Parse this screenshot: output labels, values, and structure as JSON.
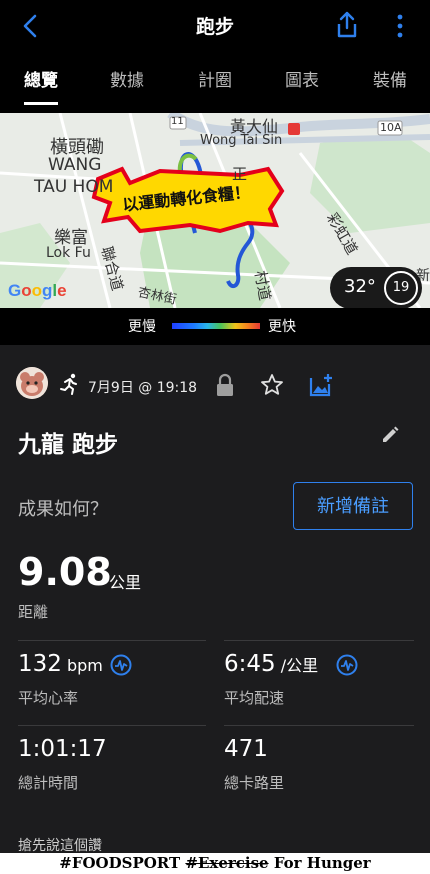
{
  "header": {
    "title": "跑步"
  },
  "tabs": [
    {
      "label": "總覽"
    },
    {
      "label": "數據"
    },
    {
      "label": "計圈"
    },
    {
      "label": "圖表"
    },
    {
      "label": "裝備"
    }
  ],
  "map": {
    "labels": {
      "wong_tai_sin_zh": "黃大仙",
      "wong_tai_sin_en": "Wong Tai Sin",
      "wang_tau_hom_zh": "橫頭磡",
      "wang_tau_hom_en1": "WANG",
      "wang_tau_hom_en2": "TAU HOM",
      "lok_fu_zh": "樂富",
      "lok_fu_en": "Lok Fu",
      "route_10a": "10A",
      "route_11": "11",
      "street_1": "聯合道",
      "street_2": "杏林街",
      "street_3": "村道",
      "street_4": "彩虹道",
      "street_5": "正",
      "edge": "新"
    },
    "sticker": "以運動轉化食糧！",
    "google": "Google",
    "temperature": "32°",
    "wind": "19"
  },
  "legend": {
    "slower": "更慢",
    "faster": "更快"
  },
  "activity": {
    "date": "7月9日 @ 19:18",
    "title": "九龍 跑步",
    "prompt": "成果如何？",
    "add_note": "新增備註",
    "distance": {
      "value": "9.08",
      "unit": "公里",
      "label": "距離"
    },
    "stats": [
      {
        "value": "132",
        "unit": " bpm",
        "label": "平均心率"
      },
      {
        "value": "6:45",
        "unit": " /公里",
        "label": "平均配速"
      },
      {
        "value": "1:01:17",
        "unit": "",
        "label": "總計時間"
      },
      {
        "value": "471",
        "unit": "",
        "label": "總卡路里"
      }
    ],
    "bottom_note": "搶先說這個讚"
  },
  "watermark": {
    "part1": "#FOODSPORT ",
    "part2": "#Exercise",
    "part3": " For Hunger"
  },
  "colors": {
    "accent": "#2f80ed",
    "background": "#1c1c1e"
  }
}
